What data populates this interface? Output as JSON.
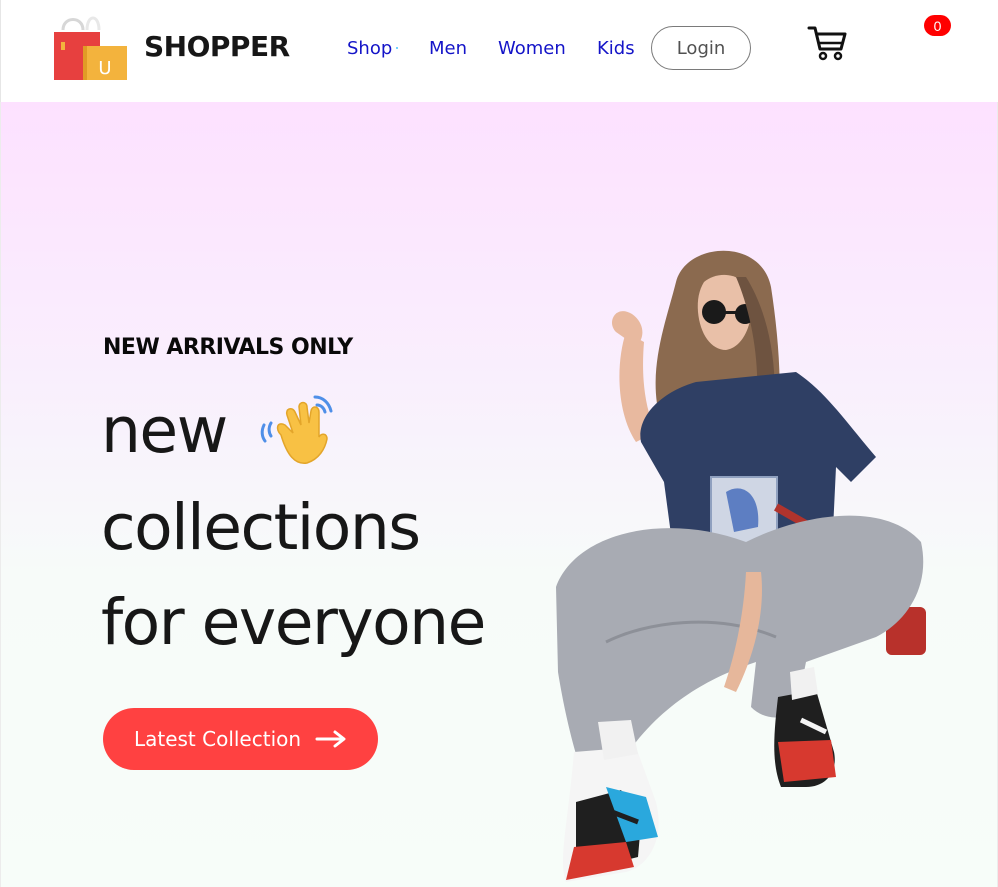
{
  "header": {
    "brand": "SHOPPER",
    "nav": [
      {
        "label": "Shop"
      },
      {
        "label": "Men"
      },
      {
        "label": "Women"
      },
      {
        "label": "Kids"
      }
    ],
    "login_label": "Login",
    "cart_count": "0",
    "logo_icon": "shopping-bags-icon",
    "logo_letter": "U",
    "cart_icon": "cart-icon"
  },
  "hero": {
    "eyebrow": "NEW ARRIVALS ONLY",
    "headline": [
      "new",
      "collections",
      "for everyone"
    ],
    "cta_label": "Latest Collection",
    "hand_icon": "waving-hand-icon",
    "arrow_icon": "arrow-right-icon"
  },
  "colors": {
    "accent": "#ff4141",
    "nav_link": "#1414c8",
    "badge": "#ff0000",
    "hero_top": "#fde1ff",
    "hero_bottom": "#f7fdf9"
  }
}
